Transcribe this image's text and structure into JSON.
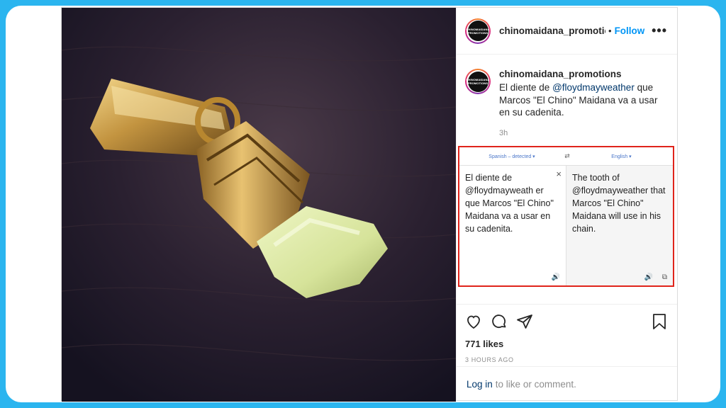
{
  "post": {
    "username": "chinomaidana_promotions",
    "header_username": "chinomaidana_promotior",
    "separator": "•",
    "follow_label": "Follow",
    "more_label": "•••",
    "avatar_text_line1": "CHINOMAIDANA",
    "avatar_text_line2": "PROMOTIONS",
    "caption": {
      "prefix": "El diente de ",
      "mention": "@floydmayweather",
      "suffix": " que Marcos \"El Chino\" Maidana va a usar en su cadenita."
    },
    "caption_time": "3h",
    "likes": "771 likes",
    "timestamp": "3 HOURS AGO",
    "login_link": "Log in",
    "login_suffix": "to like or comment."
  },
  "translate": {
    "source_lang": "Spanish – detected ▾",
    "target_lang": "English ▾",
    "swap_icon": "⇄",
    "source_text": "El diente de @floydmayweath er que Marcos \"El Chino\" Maidana va a usar en su cadenita.",
    "target_text": "The tooth of @floydmayweather that Marcos \"El Chino\" Maidana will use in his chain.",
    "close_icon": "×",
    "speaker_icon": "🔊",
    "copy_icon": "⧉"
  },
  "colors": {
    "background": "#2bb5ef",
    "link_blue": "#0095f6",
    "highlight_red": "#e0241b"
  }
}
